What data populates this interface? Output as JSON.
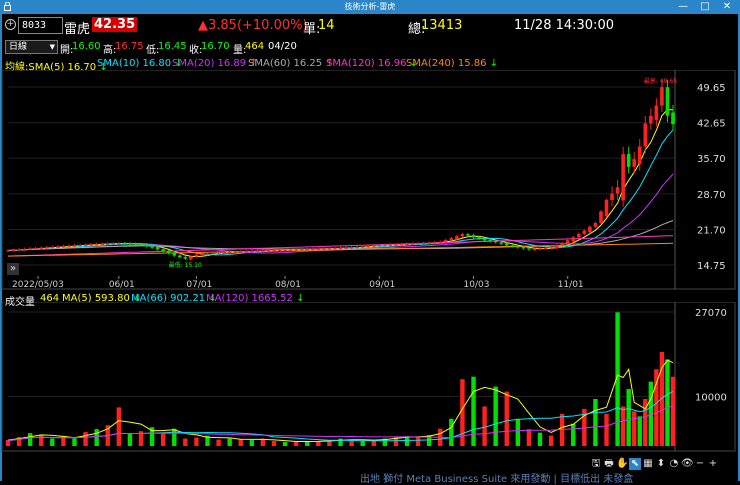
{
  "window": {
    "title": "技術分析-雷虎",
    "minimize": "—",
    "maximize": "□",
    "close": "✕"
  },
  "quote": {
    "symbol": "8033",
    "name": "雷虎",
    "price": "42.35",
    "change": "▲3.85(+10.00%)",
    "unit_label": "單:",
    "unit_value": "14",
    "total_label": "總:",
    "total_value": "13413",
    "datetime": "11/28 14:30:00"
  },
  "ohlc": {
    "period": "日線",
    "open_label": "開:",
    "open": "16.60",
    "high_label": "高:",
    "high": "16.75",
    "low_label": "低:",
    "low": "16.45",
    "close_label": "收:",
    "close": "16.70",
    "vol_label": "量:",
    "vol": "464",
    "date": "04/20"
  },
  "sma": [
    {
      "label": "均線:SMA(5) 16.70",
      "arrow": "↓",
      "color": "#ffff00"
    },
    {
      "label": "SMA(10) 16.80",
      "arrow": "↓",
      "color": "#00e5ff"
    },
    {
      "label": "SMA(20) 16.89",
      "arrow": "↑",
      "color": "#cc33ff"
    },
    {
      "label": "SMA(60) 16.25",
      "arrow": "↑",
      "color": "#aaaaaa"
    },
    {
      "label": "SMA(120) 16.96",
      "arrow": "↓",
      "color": "#ff33cc"
    },
    {
      "label": "SMA(240) 15.86",
      "arrow": "↓",
      "color": "#ff8800"
    }
  ],
  "price_axis": [
    "49.65",
    "42.65",
    "35.70",
    "28.70",
    "21.70",
    "14.75"
  ],
  "date_axis": [
    "2022/05/03",
    "06/01",
    "07/01",
    "08/01",
    "09/01",
    "10/03",
    "11/01"
  ],
  "annotations": {
    "high": "最高: 49.65",
    "low": "最低: 15.10",
    "collapse": "»"
  },
  "volume": {
    "title": "成交量",
    "value": "464",
    "ma": [
      {
        "label": "MA(5) 593.80",
        "arrow": "↓",
        "color": "#ffff00"
      },
      {
        "label": "MA(66) 902.21",
        "arrow": "↓",
        "color": "#00e5ff"
      },
      {
        "label": "MA(120) 1665.52",
        "arrow": "↓",
        "color": "#cc33ff"
      }
    ],
    "axis": [
      "27070",
      "10000"
    ]
  },
  "toolbar": [
    "🖫",
    "🖶",
    "✋",
    "⬉",
    "▦",
    "⬍",
    "◔",
    "👁",
    "−",
    "+"
  ],
  "behind_text": "出地 獅付 Meta Business Suite 來用發動 | 目標低出 未發盒 ",
  "chart_data": {
    "type": "candlestick",
    "title": "",
    "x_ticks": [
      "2022/05/03",
      "06/01",
      "07/01",
      "08/01",
      "09/01",
      "10/03",
      "11/01"
    ],
    "ylim": [
      14.75,
      49.65
    ],
    "y_ticks": [
      49.65,
      42.65,
      35.7,
      28.7,
      21.7,
      14.75
    ],
    "series": [
      {
        "name": "SMA(5)",
        "last": 16.7
      },
      {
        "name": "SMA(10)",
        "last": 16.8
      },
      {
        "name": "SMA(20)",
        "last": 16.89
      },
      {
        "name": "SMA(60)",
        "last": 16.25
      },
      {
        "name": "SMA(120)",
        "last": 16.96
      },
      {
        "name": "SMA(240)",
        "last": 15.86
      }
    ],
    "high": 49.65,
    "low": 15.1,
    "close_points": [
      [
        0,
        17.6
      ],
      [
        4,
        18.0
      ],
      [
        8,
        18.3
      ],
      [
        12,
        18.6
      ],
      [
        16,
        18.9
      ],
      [
        20,
        19.0
      ],
      [
        24,
        18.8
      ],
      [
        28,
        17.5
      ],
      [
        30,
        16.6
      ],
      [
        32,
        16.0
      ],
      [
        34,
        16.8
      ],
      [
        38,
        17.2
      ],
      [
        42,
        17.4
      ],
      [
        46,
        17.6
      ],
      [
        50,
        17.7
      ],
      [
        54,
        17.9
      ],
      [
        58,
        18.0
      ],
      [
        62,
        18.2
      ],
      [
        66,
        18.6
      ],
      [
        70,
        18.8
      ],
      [
        74,
        19.0
      ],
      [
        78,
        19.3
      ],
      [
        80,
        20.0
      ],
      [
        82,
        20.8
      ],
      [
        84,
        20.2
      ],
      [
        86,
        19.6
      ],
      [
        88,
        19.2
      ],
      [
        90,
        18.6
      ],
      [
        92,
        18.2
      ],
      [
        94,
        17.8
      ],
      [
        96,
        18.0
      ],
      [
        98,
        18.2
      ],
      [
        100,
        19.0
      ],
      [
        102,
        20.2
      ],
      [
        104,
        21.5
      ],
      [
        106,
        23.0
      ],
      [
        108,
        27.5
      ],
      [
        110,
        30.0
      ],
      [
        111,
        36.5
      ],
      [
        112,
        34.0
      ],
      [
        113,
        35.5
      ],
      [
        114,
        38.0
      ],
      [
        115,
        42.5
      ],
      [
        116,
        44.0
      ],
      [
        117,
        46.0
      ],
      [
        118,
        49.6
      ],
      [
        119,
        44.0
      ],
      [
        120,
        42.35
      ]
    ],
    "volume": {
      "axis": [
        27070,
        10000
      ],
      "bars": [
        [
          0,
          1200,
          1
        ],
        [
          2,
          1800,
          1
        ],
        [
          4,
          2600,
          0
        ],
        [
          6,
          2300,
          1
        ],
        [
          8,
          1500,
          0
        ],
        [
          10,
          2000,
          1
        ],
        [
          12,
          1500,
          0
        ],
        [
          14,
          2800,
          1
        ],
        [
          16,
          3400,
          0
        ],
        [
          18,
          4200,
          1
        ],
        [
          20,
          7800,
          1
        ],
        [
          22,
          2500,
          0
        ],
        [
          24,
          3000,
          1
        ],
        [
          26,
          3800,
          0
        ],
        [
          28,
          2600,
          1
        ],
        [
          30,
          3500,
          0
        ],
        [
          32,
          1500,
          1
        ],
        [
          34,
          1700,
          1
        ],
        [
          36,
          2100,
          0
        ],
        [
          38,
          1300,
          1
        ],
        [
          40,
          1500,
          0
        ],
        [
          42,
          1300,
          1
        ],
        [
          44,
          1200,
          0
        ],
        [
          46,
          1500,
          1
        ],
        [
          48,
          1000,
          1
        ],
        [
          50,
          800,
          0
        ],
        [
          52,
          900,
          1
        ],
        [
          54,
          1000,
          0
        ],
        [
          56,
          900,
          1
        ],
        [
          58,
          1100,
          1
        ],
        [
          60,
          1500,
          0
        ],
        [
          62,
          1200,
          1
        ],
        [
          64,
          1100,
          0
        ],
        [
          66,
          1300,
          1
        ],
        [
          68,
          1500,
          0
        ],
        [
          70,
          1800,
          1
        ],
        [
          72,
          2000,
          0
        ],
        [
          74,
          1800,
          1
        ],
        [
          76,
          2200,
          0
        ],
        [
          78,
          3500,
          1
        ],
        [
          80,
          5500,
          0
        ],
        [
          82,
          13500,
          1
        ],
        [
          84,
          14000,
          0
        ],
        [
          86,
          8000,
          1
        ],
        [
          88,
          12000,
          0
        ],
        [
          90,
          11000,
          1
        ],
        [
          92,
          5500,
          0
        ],
        [
          94,
          3400,
          1
        ],
        [
          96,
          2700,
          0
        ],
        [
          98,
          2100,
          1
        ],
        [
          100,
          6500,
          1
        ],
        [
          102,
          4500,
          0
        ],
        [
          104,
          7500,
          1
        ],
        [
          106,
          9500,
          0
        ],
        [
          108,
          6500,
          1
        ],
        [
          110,
          27000,
          0
        ],
        [
          111,
          8000,
          1
        ],
        [
          112,
          11500,
          0
        ],
        [
          113,
          7000,
          1
        ],
        [
          114,
          6000,
          0
        ],
        [
          115,
          9500,
          1
        ],
        [
          116,
          13000,
          0
        ],
        [
          117,
          15500,
          1
        ],
        [
          118,
          19000,
          1
        ],
        [
          119,
          17500,
          0
        ],
        [
          120,
          14000,
          1
        ]
      ]
    }
  }
}
